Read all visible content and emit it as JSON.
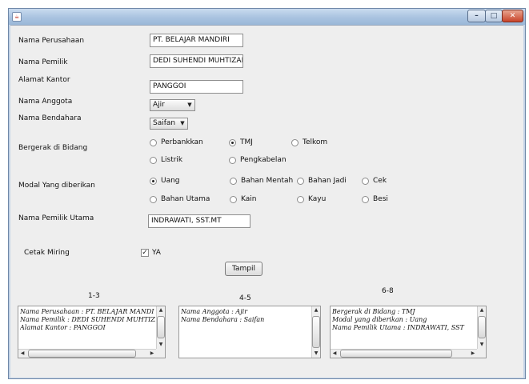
{
  "window": {
    "title": "",
    "icon": "java-icon"
  },
  "form": {
    "nama_perusahaan": {
      "label": "Nama Perusahaan",
      "value": "PT. BELAJAR MANDIRI"
    },
    "nama_pemilik": {
      "label": "Nama Pemilik",
      "value": "DEDI SUHENDI MUHTIZAR"
    },
    "alamat_kantor": {
      "label": "Alamat Kantor",
      "value": "PANGGOI"
    },
    "nama_anggota": {
      "label": "Nama Anggota",
      "value": "Ajir"
    },
    "nama_bendahara": {
      "label": "Nama Bendahara",
      "value": "Saifan"
    },
    "bergerak": {
      "label": "Bergerak di Bidang",
      "options": [
        "Perbankkan",
        "TMJ",
        "Telkom",
        "Listrik",
        "Pengkabelan"
      ],
      "selected": "TMJ"
    },
    "modal": {
      "label": "Modal Yang diberikan",
      "options": [
        "Uang",
        "Bahan Mentah",
        "Bahan Jadi",
        "Cek",
        "Bahan Utama",
        "Kain",
        "Kayu",
        "Besi"
      ],
      "selected": "Uang"
    },
    "pemilik_utama": {
      "label": "Nama Pemilik Utama",
      "value": "INDRAWATI, SST.MT"
    },
    "cetak_miring": {
      "label": "Cetak Miring",
      "check_label": "YA",
      "checked": true
    },
    "tampil_button": "Tampil"
  },
  "outputs": [
    {
      "title": "1-3",
      "lines": [
        "Nama Perusahaan : PT. BELAJAR MANDI",
        "Nama Pemilik : DEDI SUHENDI MUHTIZA",
        "Alamat Kantor : PANGGOI"
      ]
    },
    {
      "title": "4-5",
      "lines": [
        "Nama Anggota : Ajir",
        "Nama Bendahara : Saifan",
        ""
      ]
    },
    {
      "title": "6-8",
      "lines": [
        "Bergerak di Bidang : TMJ",
        "Modal yang diberikan : Uang",
        "Nama Pemilik Utama : INDRAWATI, SST"
      ]
    }
  ]
}
